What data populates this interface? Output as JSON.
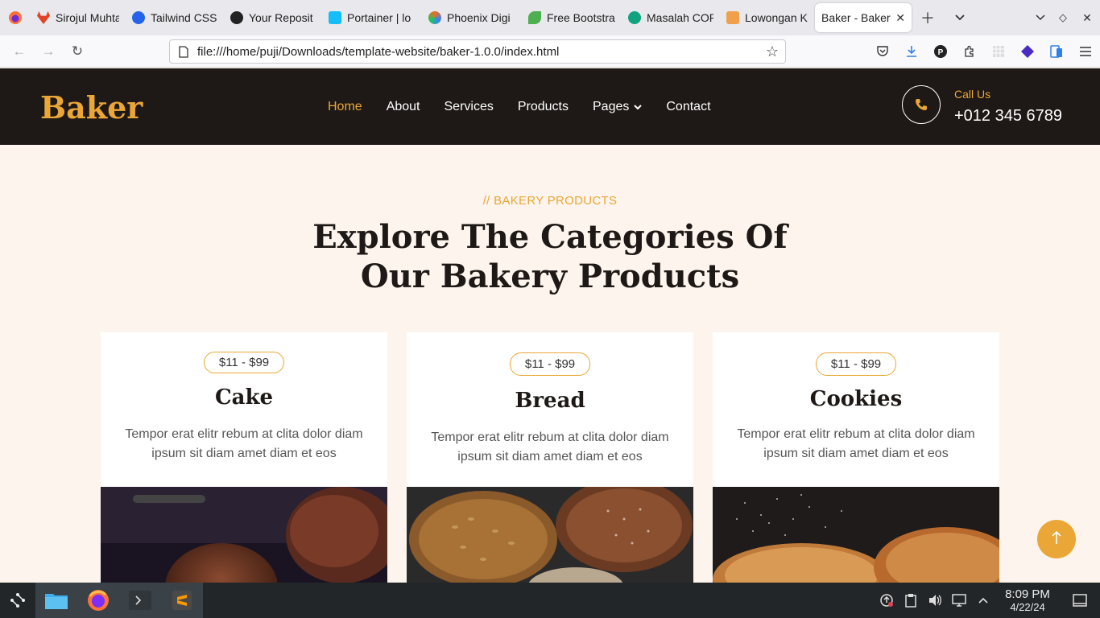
{
  "browser": {
    "tabs": [
      {
        "title": "Sirojul Muhta",
        "favicon": "gitlab-icon",
        "color": "#e24329"
      },
      {
        "title": "Tailwind CSS",
        "favicon": "tailwind-icon",
        "color": "#2563eb"
      },
      {
        "title": "Your Reposit",
        "favicon": "github-icon",
        "color": "#222222"
      },
      {
        "title": "Portainer | lo",
        "favicon": "portainer-icon",
        "color": "#13bef9"
      },
      {
        "title": "Phoenix Digi",
        "favicon": "phoenix-icon",
        "color": "#f26b1d"
      },
      {
        "title": "Free Bootstra",
        "favicon": "leaf-icon",
        "color": "#4caf50"
      },
      {
        "title": "Masalah COR",
        "favicon": "chatgpt-icon",
        "color": "#10a37f"
      },
      {
        "title": "Lowongan K",
        "favicon": "doc-icon",
        "color": "#f0a04b"
      },
      {
        "title": "Baker - Bakery",
        "favicon": "page-icon",
        "color": "#888888",
        "active": true
      }
    ],
    "url": "file:///home/puji/Downloads/template-website/baker-1.0.0/index.html"
  },
  "site": {
    "brand": "Baker",
    "nav": [
      {
        "label": "Home",
        "active": true
      },
      {
        "label": "About"
      },
      {
        "label": "Services"
      },
      {
        "label": "Products"
      },
      {
        "label": "Pages",
        "dropdown": true
      },
      {
        "label": "Contact"
      }
    ],
    "call_label": "Call Us",
    "call_number": "+012 345 6789",
    "accent": "#eaa636",
    "dark": "#1e1916"
  },
  "section": {
    "tag": "// BAKERY PRODUCTS",
    "title_line1": "Explore The Categories Of",
    "title_line2": "Our Bakery Products"
  },
  "cards": [
    {
      "price": "$11 - $99",
      "title": "Cake",
      "desc": "Tempor erat elitr rebum at clita dolor diam ipsum sit diam amet diam et eos"
    },
    {
      "price": "$11 - $99",
      "title": "Bread",
      "desc": "Tempor erat elitr rebum at clita dolor diam ipsum sit diam amet diam et eos"
    },
    {
      "price": "$11 - $99",
      "title": "Cookies",
      "desc": "Tempor erat elitr rebum at clita dolor diam ipsum sit diam amet diam et eos"
    }
  ],
  "taskbar": {
    "time": "8:09 PM",
    "date": "4/22/24"
  }
}
